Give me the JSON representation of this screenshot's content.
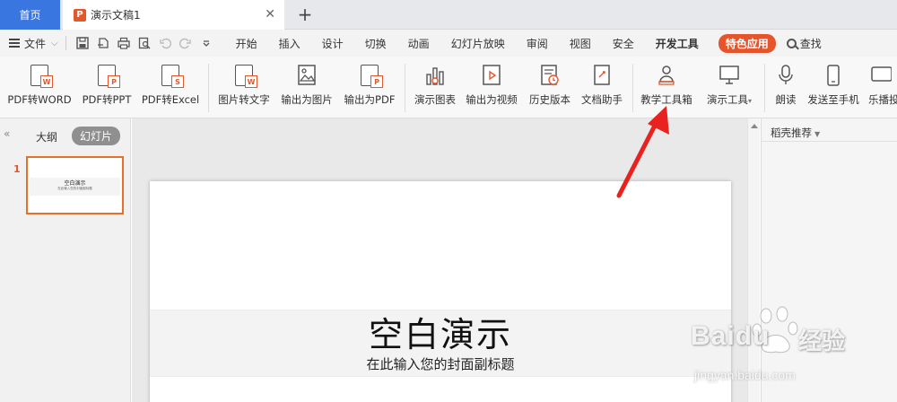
{
  "tabs": {
    "home": "首页",
    "document": "演示文稿1",
    "ppt_icon": "P",
    "close": "✕",
    "add": "+"
  },
  "menubar": {
    "file": "文件",
    "items": [
      "开始",
      "插入",
      "设计",
      "切换",
      "动画",
      "幻灯片放映",
      "审阅",
      "视图",
      "安全",
      "开发工具"
    ],
    "special": "特色应用",
    "search": "查找"
  },
  "ribbon": {
    "buttons": [
      {
        "label": "PDF转WORD",
        "badge": "W",
        "icon": "pdf-to-word-icon"
      },
      {
        "label": "PDF转PPT",
        "badge": "P",
        "icon": "pdf-to-ppt-icon"
      },
      {
        "label": "PDF转Excel",
        "badge": "S",
        "icon": "pdf-to-excel-icon"
      },
      {
        "label": "图片转文字",
        "badge": "W",
        "icon": "image-to-text-icon"
      },
      {
        "label": "输出为图片",
        "icon": "export-image-icon"
      },
      {
        "label": "输出为PDF",
        "badge": "P",
        "icon": "export-pdf-icon"
      },
      {
        "label": "演示图表",
        "icon": "chart-icon"
      },
      {
        "label": "输出为视频",
        "icon": "export-video-icon"
      },
      {
        "label": "历史版本",
        "icon": "history-icon"
      },
      {
        "label": "文档助手",
        "icon": "document-assistant-icon"
      },
      {
        "label": "教学工具箱",
        "icon": "teaching-toolbox-icon"
      },
      {
        "label": "演示工具",
        "icon": "presentation-tools-icon"
      },
      {
        "label": "朗读",
        "icon": "read-aloud-icon"
      },
      {
        "label": "发送至手机",
        "icon": "send-to-phone-icon"
      },
      {
        "label": "乐播投",
        "icon": "screen-cast-icon"
      }
    ]
  },
  "leftpanel": {
    "collapse": "«",
    "outline_tab": "大纲",
    "slides_tab": "幻灯片",
    "slide_number": "1"
  },
  "slide": {
    "title": "空白演示",
    "subtitle": "在此输入您的封面副标题"
  },
  "rightpanel": {
    "title": "稻壳推荐",
    "dropdown": "▼"
  },
  "watermark": {
    "brand": "Baidu",
    "cn": "经验",
    "url": "jingyan.baidu.com"
  },
  "colors": {
    "accent_orange": "#e5542a",
    "home_tab_blue": "#3a76e0",
    "arrow_red": "#e8221f"
  }
}
